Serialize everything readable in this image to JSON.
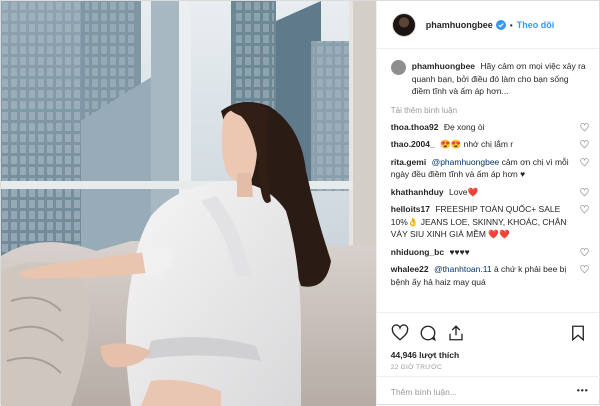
{
  "post": {
    "username": "phamhuongbee",
    "follow_label": "Theo dõi",
    "separator": "•",
    "caption": "Hãy cảm ơn mọi việc xảy ra quanh bạn, bởi điều đó làm cho bạn sống điềm tĩnh và ấm áp hơn...",
    "load_more": "Tải thêm bình luận",
    "likes": "44,946 lượt thích",
    "time_ago": "22 GIỜ TRƯỚC",
    "add_comment_placeholder": "Thêm bình luận...",
    "more_dots": "•••"
  },
  "comments": [
    {
      "user": "thoa.thoa92",
      "text": "Đẹ xong òi"
    },
    {
      "user": "thao.2004_",
      "text": "😍😍 nhớ chị lắm r"
    },
    {
      "user": "rita.gemi",
      "mention": "@phamhuongbee",
      "text": "cảm ơn chị vì mỗi ngày đều điềm tĩnh và ấm áp hơn ♥"
    },
    {
      "user": "khathanhduy",
      "text": "Love❤️"
    },
    {
      "user": "helloits17",
      "text": "FREESHIP TOÀN QUỐC+ SALE 10%👌 JEANS LOE, SKINNY, KHOÁC, CHÂN VÁY SIU XINH GIÁ MỀM ❤️❤️"
    },
    {
      "user": "nhiduong_bc",
      "text": "♥♥♥♥"
    },
    {
      "user": "whalee22",
      "mention": "@thanhtoan.11",
      "text": "à chứ k phải bee bị bệnh ấy hả haiz may quá"
    }
  ],
  "icons": [
    "verified-badge-icon",
    "heart-icon",
    "comment-icon",
    "share-icon",
    "bookmark-icon"
  ],
  "colors": {
    "accent": "#3897f0",
    "muted": "#999999",
    "text": "#262626",
    "mention": "#003569"
  }
}
